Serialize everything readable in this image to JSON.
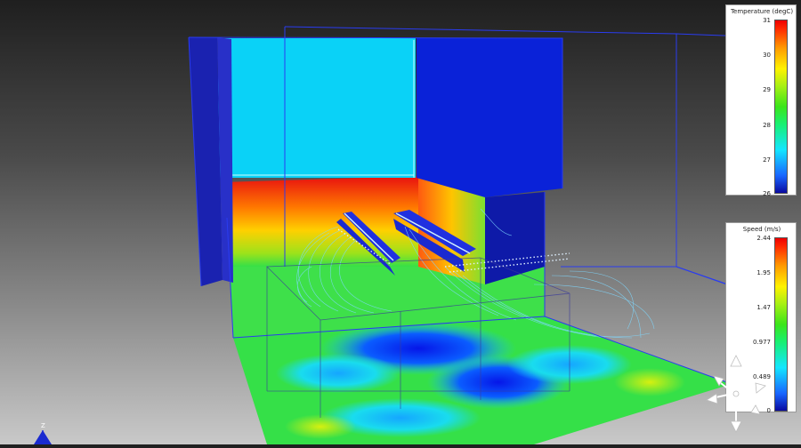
{
  "legends": {
    "temperature": {
      "title": "Temperature (degC)",
      "ticks": [
        "31",
        "30",
        "29",
        "28",
        "27",
        "26"
      ],
      "range": [
        26,
        31
      ]
    },
    "speed": {
      "title": "Speed (m/s)",
      "ticks": [
        "2.44",
        "1.95",
        "1.47",
        "0.977",
        "0.489",
        "0"
      ],
      "range": [
        0,
        2.44
      ]
    }
  },
  "axis_triad": {
    "label": "Z"
  },
  "colors": {
    "wall_cyan": "#0ad2f7",
    "wall_blue": "#0a22d8",
    "frame_blue": "#2a3cf0",
    "hot_red": "#f02010",
    "floor_green": "#35e048"
  },
  "icons": [
    "navigation-cube-icon",
    "axis-triad-icon"
  ]
}
